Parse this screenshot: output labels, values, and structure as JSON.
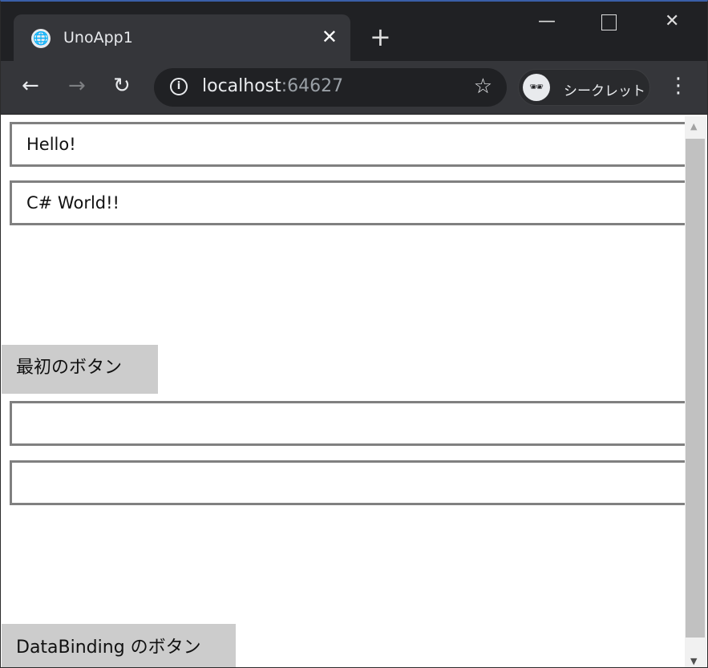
{
  "browser": {
    "tab_title": "UnoApp1",
    "url_host": "localhost",
    "url_port": ":64627",
    "incognito_label": "シークレット"
  },
  "page": {
    "textbox1": "Hello!",
    "textbox2": "C# World!!",
    "button1": "最初のボタン",
    "textbox3": "",
    "textbox4": "",
    "button2": "DataBinding のボタン"
  }
}
